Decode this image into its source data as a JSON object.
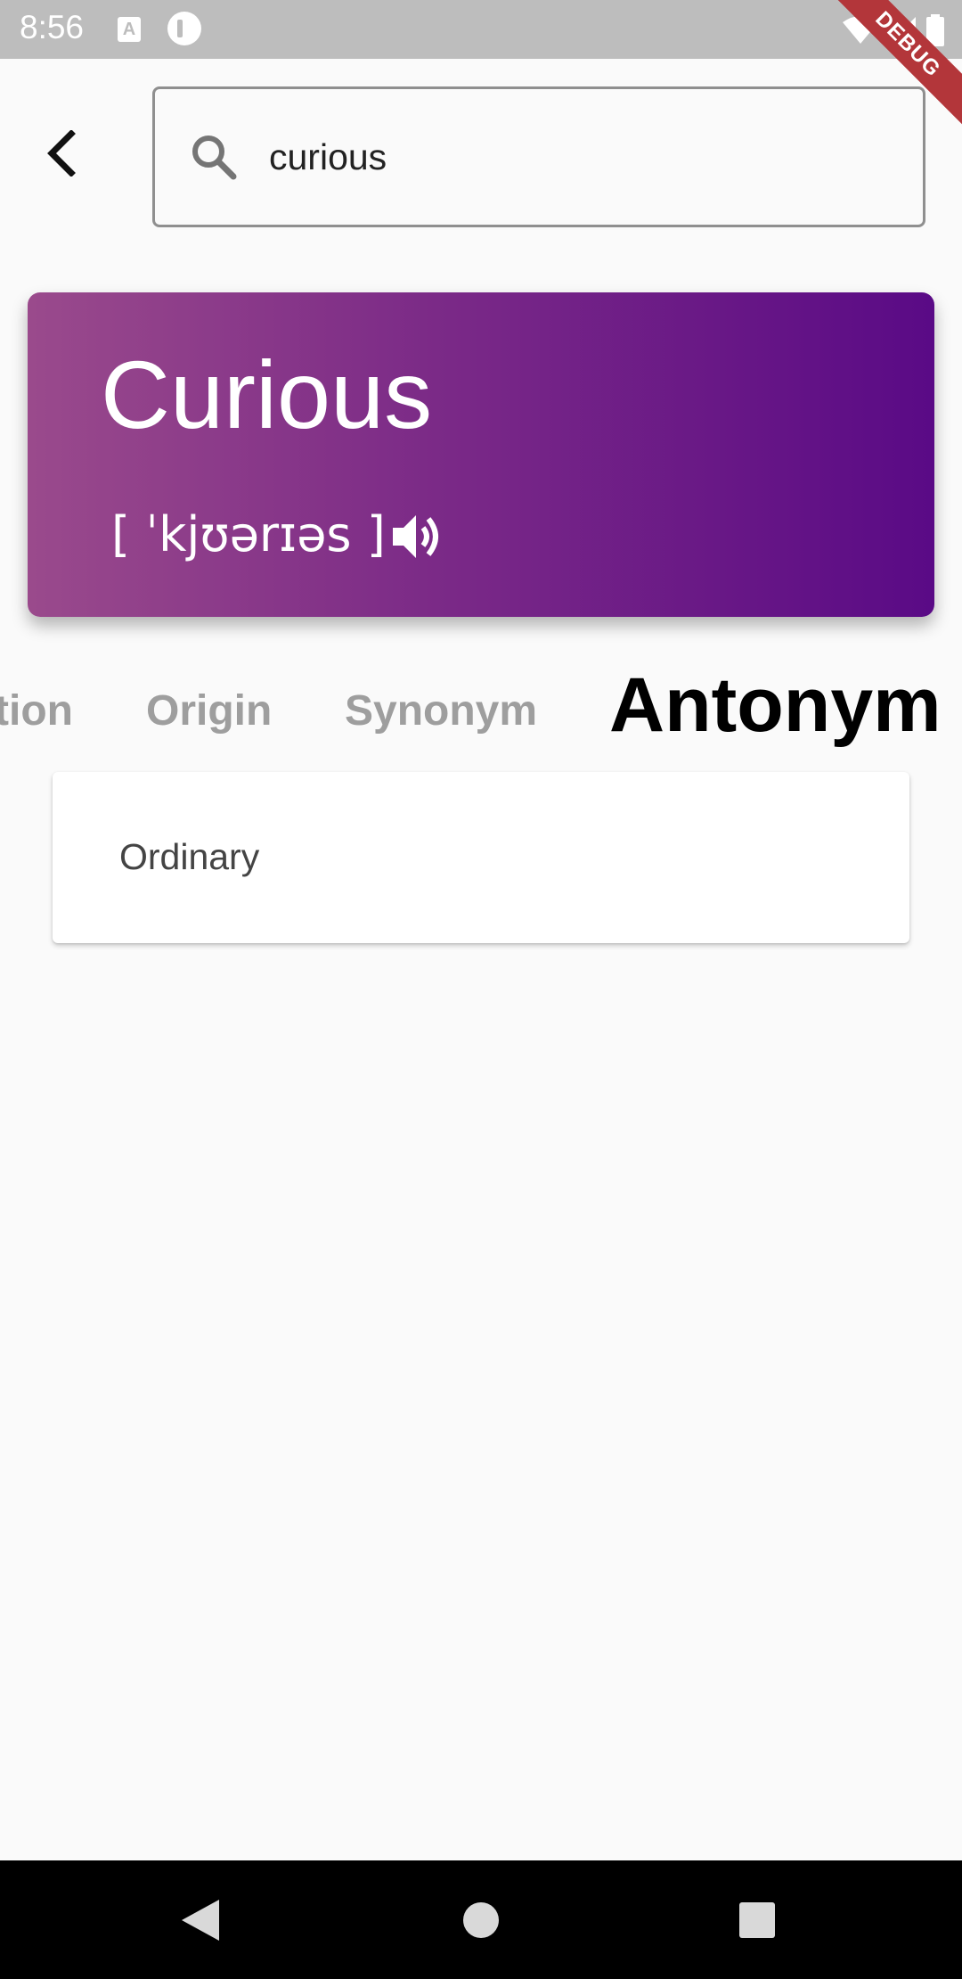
{
  "status_bar": {
    "time": "8:56",
    "icons": [
      "keyboard-a-icon",
      "notification-icon",
      "wifi-icon",
      "signal-icon",
      "battery-icon"
    ],
    "debug_label": "DEBUG"
  },
  "search": {
    "value": "curious",
    "icon": "search-icon"
  },
  "word": {
    "title": "Curious",
    "phonetic": "[ ˈkjʊərɪəs ]",
    "gradient_colors": [
      "#9a4a8c",
      "#5a0a86"
    ]
  },
  "tabs": [
    {
      "label": "tion"
    },
    {
      "label": "Origin"
    },
    {
      "label": "Synonym"
    },
    {
      "label": "Antonym",
      "active": true
    }
  ],
  "results": [
    {
      "text": "Ordinary"
    }
  ],
  "nav_bar": {
    "buttons": [
      "back-icon",
      "home-icon",
      "recents-icon"
    ]
  }
}
